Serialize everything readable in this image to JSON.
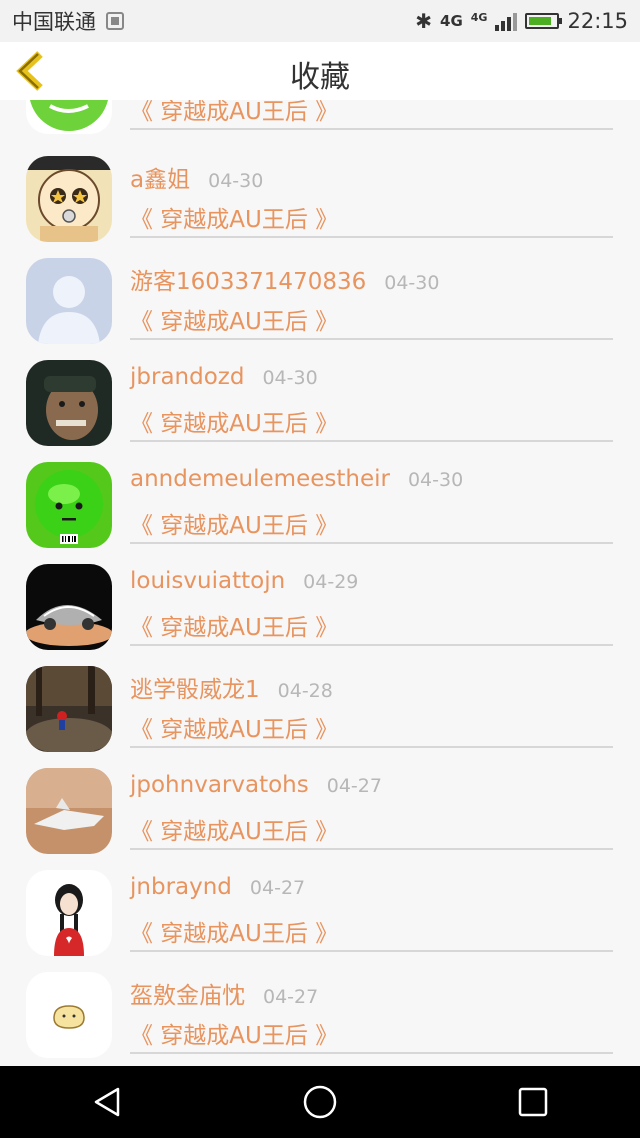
{
  "status_bar": {
    "carrier": "中国联通",
    "network_1": "4G",
    "network_2": "4G",
    "time": "22:15",
    "battery_level": 0.85
  },
  "header": {
    "title": "收藏"
  },
  "items": [
    {
      "name": "",
      "date": "",
      "book": "《 穿越成AU王后 》"
    },
    {
      "name": "a鑫姐",
      "date": "04-30",
      "book": "《 穿越成AU王后 》"
    },
    {
      "name": "游客1603371470836",
      "date": "04-30",
      "book": "《 穿越成AU王后 》"
    },
    {
      "name": "jbrandozd",
      "date": "04-30",
      "book": "《 穿越成AU王后 》"
    },
    {
      "name": "anndemeulemeestheir",
      "date": "04-30",
      "book": "《 穿越成AU王后 》"
    },
    {
      "name": "louisvuiattojn",
      "date": "04-29",
      "book": "《 穿越成AU王后 》"
    },
    {
      "name": "逃学骰威龙1",
      "date": "04-28",
      "book": "《 穿越成AU王后 》"
    },
    {
      "name": "jpohnvarvatohs",
      "date": "04-27",
      "book": "《 穿越成AU王后 》"
    },
    {
      "name": "jnbraynd",
      "date": "04-27",
      "book": "《 穿越成AU王后 》"
    },
    {
      "name": "盔敫金庙忱",
      "date": "04-27",
      "book": "《 穿越成AU王后 》"
    }
  ],
  "colors": {
    "accent": "#e8945f",
    "date": "#b7b7b7",
    "divider": "#d7d7d7"
  }
}
